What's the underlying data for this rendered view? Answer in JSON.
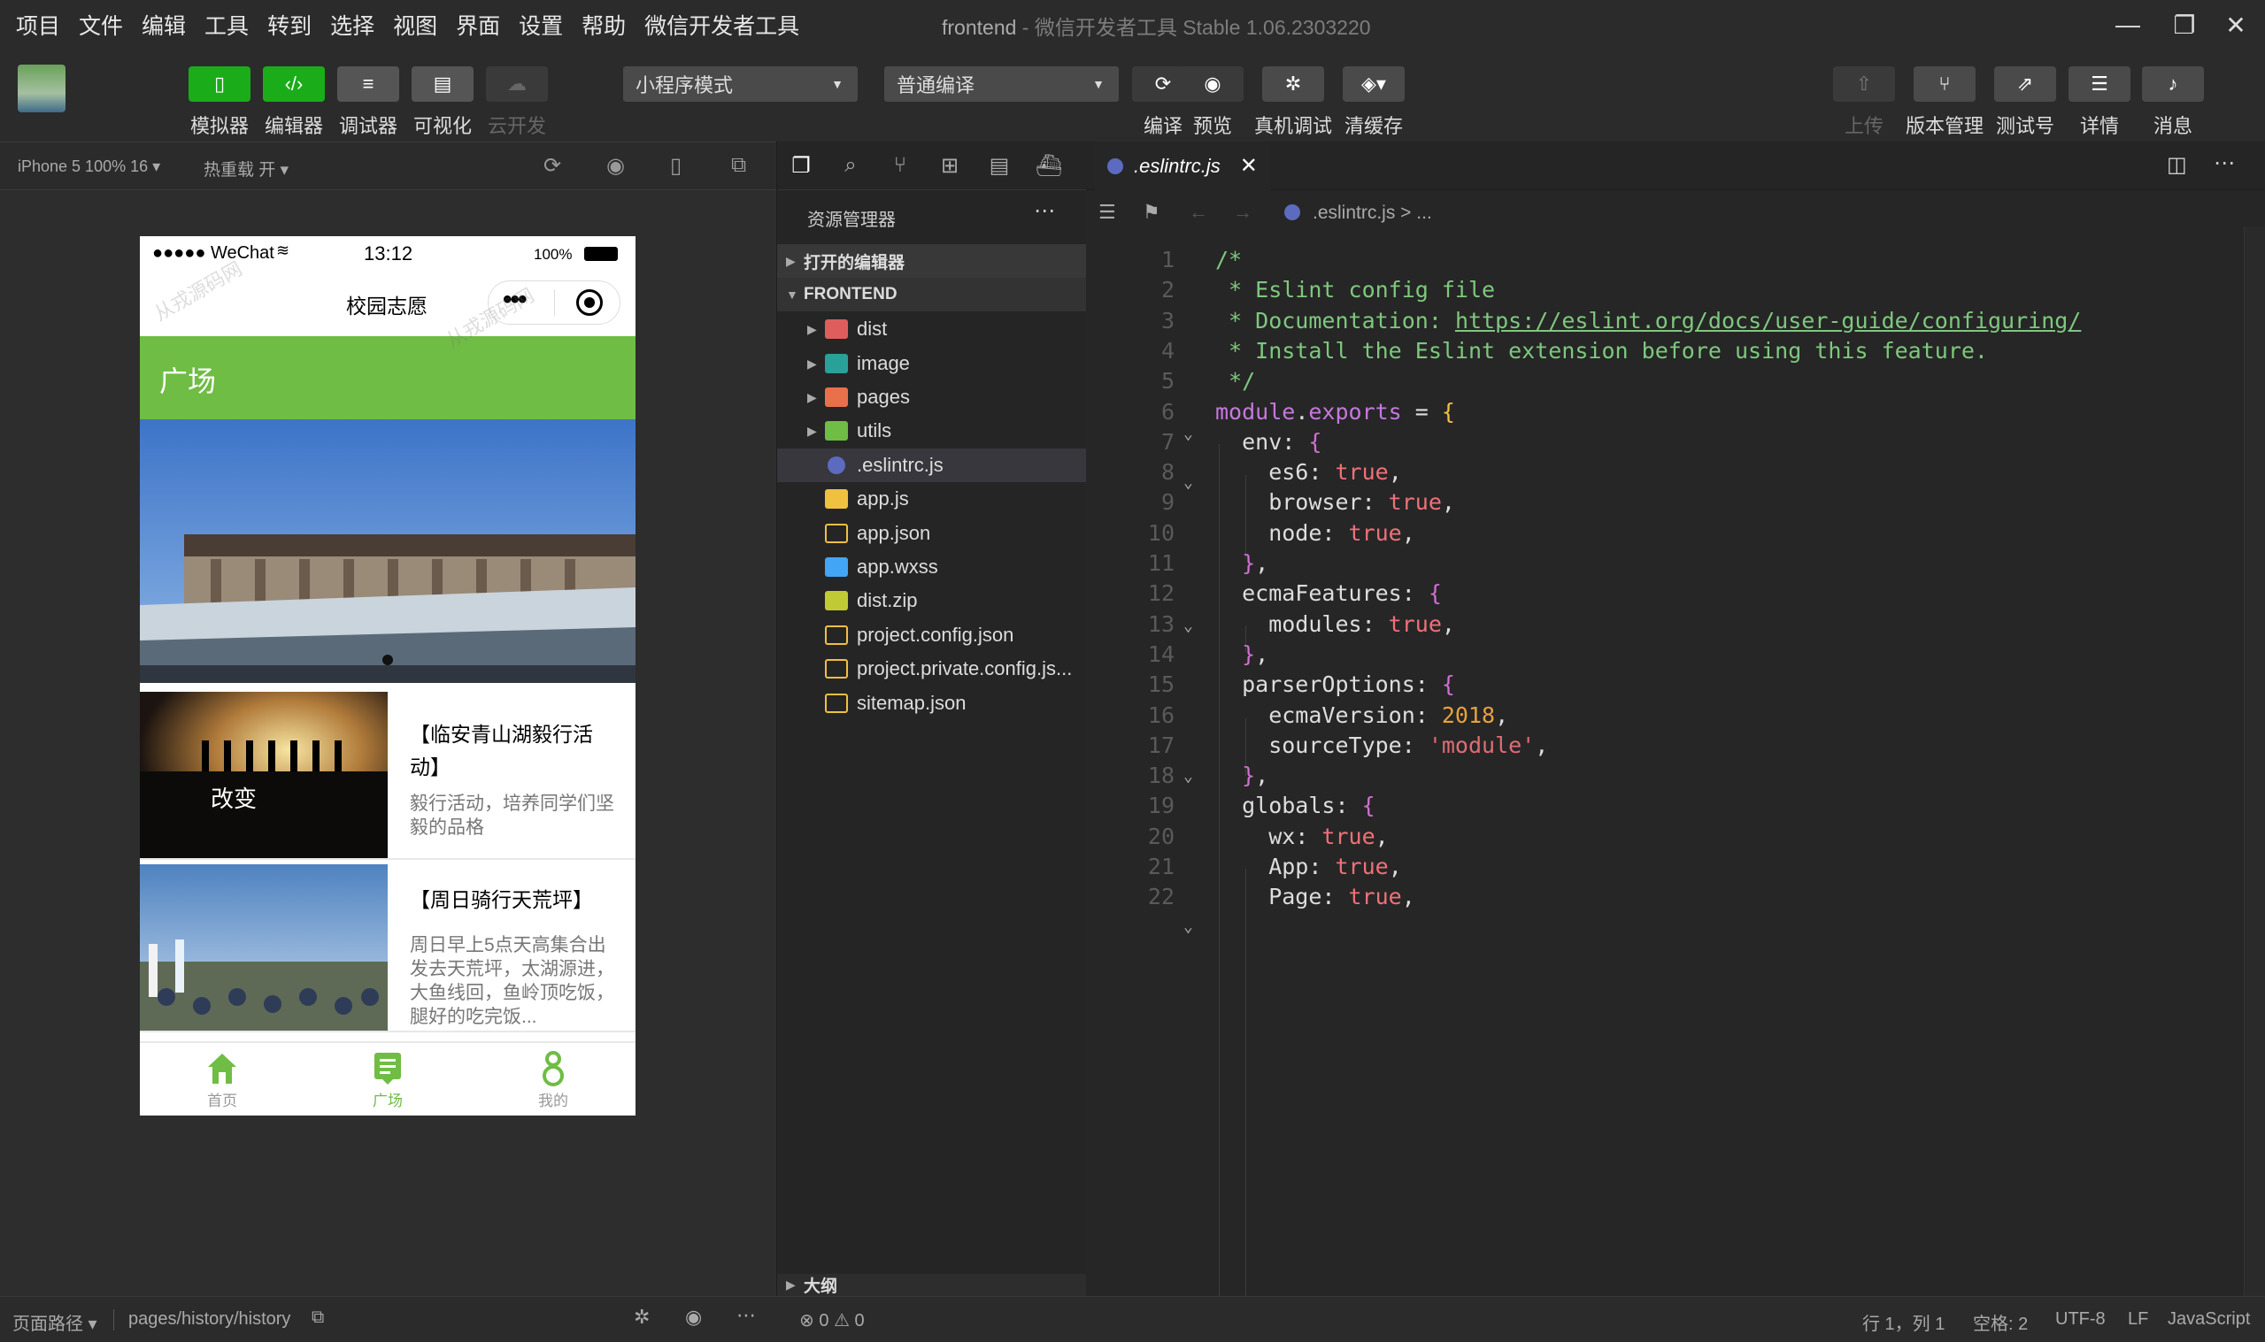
{
  "menu": {
    "items": [
      "项目",
      "文件",
      "编辑",
      "工具",
      "转到",
      "选择",
      "视图",
      "界面",
      "设置",
      "帮助",
      "微信开发者工具"
    ]
  },
  "window": {
    "title": "frontend",
    "subtitle": "- 微信开发者工具 Stable 1.06.2303220"
  },
  "toolbar": {
    "simulator": "模拟器",
    "editor": "编辑器",
    "debugger": "调试器",
    "visual": "可视化",
    "cloud": "云开发",
    "mode_select": "小程序模式",
    "compile_select": "普通编译",
    "compile": "编译",
    "preview": "预览",
    "realdebug": "真机调试",
    "clearcache": "清缓存",
    "upload": "上传",
    "version": "版本管理",
    "testid": "测试号",
    "details": "详情",
    "messages": "消息"
  },
  "simulator": {
    "device": "iPhone 5 100% 16 ▾",
    "hotreload": "热重载 开 ▾",
    "status": {
      "carrier": "●●●●● WeChat",
      "time": "13:12",
      "battery": "100%"
    },
    "nav_title": "校园志愿",
    "header_title": "广场",
    "cards": [
      {
        "title": "【临安青山湖毅行活动】",
        "desc": "毅行活动，培养同学们坚毅的品格"
      },
      {
        "title": "【周日骑行天荒坪】",
        "desc": "周日早上5点天高集合出发去天荒坪，太湖源进，大鱼线回，鱼岭顶吃饭，腿好的吃完饭..."
      }
    ],
    "tabs": [
      "首页",
      "广场",
      "我的"
    ],
    "watermark": "从戎源码网"
  },
  "simfooter": {
    "path_label": "页面路径 ▾",
    "path": "pages/history/history"
  },
  "explorer": {
    "title": "资源管理器",
    "open_editors": "打开的编辑器",
    "project": "FRONTEND",
    "items": [
      {
        "name": "dist",
        "type": "folder",
        "color": "#e05d5d"
      },
      {
        "name": "image",
        "type": "folder",
        "color": "#2aa198"
      },
      {
        "name": "pages",
        "type": "folder",
        "color": "#e8704a"
      },
      {
        "name": "utils",
        "type": "folder",
        "color": "#6fbd44"
      },
      {
        "name": ".eslintrc.js",
        "type": "file",
        "color": "#5c6bc0"
      },
      {
        "name": "app.js",
        "type": "file",
        "color": "#f0c040"
      },
      {
        "name": "app.json",
        "type": "file",
        "color": "#f0c040"
      },
      {
        "name": "app.wxss",
        "type": "file",
        "color": "#42a5f5"
      },
      {
        "name": "dist.zip",
        "type": "file",
        "color": "#c0ca33"
      },
      {
        "name": "project.config.json",
        "type": "file",
        "color": "#f0c040"
      },
      {
        "name": "project.private.config.js...",
        "type": "file",
        "color": "#f0c040"
      },
      {
        "name": "sitemap.json",
        "type": "file",
        "color": "#f0c040"
      }
    ],
    "outline": "大纲",
    "problems": "⊗ 0 ⚠ 0"
  },
  "editor": {
    "tab": ".eslintrc.js",
    "breadcrumb": ".eslintrc.js > ...",
    "lines": [
      "/*",
      " * Eslint config file",
      " * Documentation: https://eslint.org/docs/user-guide/configuring/",
      " * Install the Eslint extension before using this feature.",
      " */",
      "module.exports = {",
      "  env: {",
      "    es6: true,",
      "    browser: true,",
      "    node: true,",
      "  },",
      "  ecmaFeatures: {",
      "    modules: true,",
      "  },",
      "  parserOptions: {",
      "    ecmaVersion: 2018,",
      "    sourceType: 'module',",
      "  },",
      "  globals: {",
      "    wx: true,",
      "    App: true,",
      "    Page: true,"
    ],
    "line_numbers": [
      "1",
      "2",
      "3",
      "4",
      "5",
      "6",
      "7",
      "8",
      "9",
      "10",
      "11",
      "12",
      "13",
      "14",
      "15",
      "16",
      "17",
      "18",
      "19",
      "20",
      "21",
      "22"
    ]
  },
  "statusbar": {
    "position": "行 1，列 1",
    "spaces": "空格: 2",
    "encoding": "UTF-8",
    "eol": "LF",
    "language": "JavaScript"
  }
}
